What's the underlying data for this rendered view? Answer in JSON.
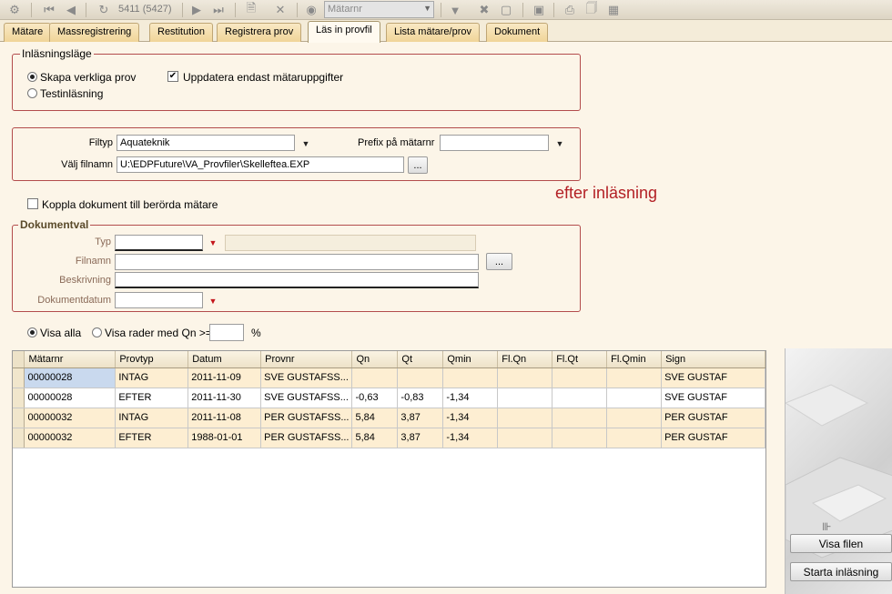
{
  "toolbar": {
    "record_counter": "5411 (5427)",
    "search_field_placeholder": "Mätarnr",
    "icons": [
      "meter-icon",
      "first-record-icon",
      "previous-record-icon",
      "refresh-icon",
      "next-record-icon",
      "last-record-icon",
      "new-record-icon",
      "delete-icon",
      "binoculars-icon",
      "filter-icon",
      "clear-filter-icon",
      "display-icon",
      "form-icon",
      "print-icon",
      "print-preview-icon",
      "export-icon"
    ]
  },
  "tabs": [
    {
      "label": "Mätare",
      "active": false
    },
    {
      "label": "Massregistrering",
      "active": false
    },
    {
      "label": "Restitution",
      "active": false
    },
    {
      "label": "Registrera prov",
      "active": false
    },
    {
      "label": "Läs in provfil",
      "active": true
    },
    {
      "label": "Lista mätare/prov",
      "active": false
    },
    {
      "label": "Dokument",
      "active": false
    }
  ],
  "import_mode": {
    "legend": "Inläsningsläge",
    "real_samples_label": "Skapa verkliga prov",
    "real_samples_selected": true,
    "test_import_label": "Testinläsning",
    "test_import_selected": false,
    "update_only_label": "Uppdatera endast mätaruppgifter",
    "update_only_checked": true
  },
  "file": {
    "filetype_label": "Filtyp",
    "filetype_value": "Aquateknik",
    "prefix_label": "Prefix på mätarnr",
    "prefix_value": "",
    "filename_label": "Välj filnamn",
    "filename_value": "U:\\EDPFuture\\VA_Provfiler\\Skelleftea.EXP",
    "browse_label": "..."
  },
  "annotation": "efter inläsning",
  "link_documents_label": "Koppla dokument till berörda mätare",
  "link_documents_checked": false,
  "document": {
    "legend": "Dokumentval",
    "type_label": "Typ",
    "type_value": "",
    "type_description": "",
    "filename_label": "Filnamn",
    "filename_value": "",
    "browse_label": "...",
    "description_label": "Beskrivning",
    "description_value": "",
    "date_label": "Dokumentdatum",
    "date_value": ""
  },
  "filter": {
    "show_all_label": "Visa alla",
    "show_all_selected": true,
    "show_rows_label": "Visa rader med Qn >=",
    "qn_value": "",
    "percent_label": "%"
  },
  "grid": {
    "columns": [
      "Mätarnr",
      "Provtyp",
      "Datum",
      "Provnr",
      "Qn",
      "Qt",
      "Qmin",
      "Fl.Qn",
      "Fl.Qt",
      "Fl.Qmin",
      "Sign"
    ],
    "rows": [
      [
        "00000028",
        "INTAG",
        "2011-11-09",
        "SVE GUSTAFSS...",
        "",
        "",
        "",
        "",
        "",
        "",
        "SVE GUSTAF"
      ],
      [
        "00000028",
        "EFTER",
        "2011-11-30",
        "SVE GUSTAFSS...",
        "-0,63",
        "-0,83",
        "-1,34",
        "",
        "",
        "",
        "SVE GUSTAF"
      ],
      [
        "00000032",
        "INTAG",
        "2011-11-08",
        "PER GUSTAFSS...",
        "5,84",
        "3,87",
        "-1,34",
        "",
        "",
        "",
        "PER GUSTAF"
      ],
      [
        "00000032",
        "EFTER",
        "1988-01-01",
        "PER GUSTAFSS...",
        "5,84",
        "3,87",
        "-1,34",
        "",
        "",
        "",
        "PER GUSTAF"
      ]
    ]
  },
  "actions": {
    "show_file_label": "Visa filen",
    "start_import_label": "Starta inläsning"
  },
  "colors": {
    "background": "#fcf5e8",
    "panel_border": "#b34c4c",
    "annotation": "#b32025",
    "row_highlight": "#fdeed2",
    "selected_cell": "#c9d9ee"
  }
}
